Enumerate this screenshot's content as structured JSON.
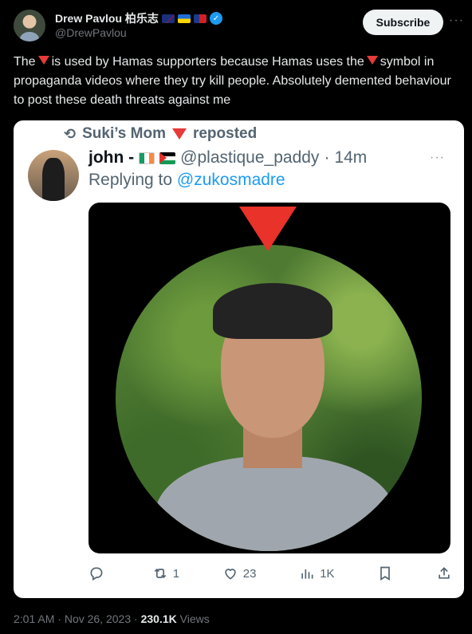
{
  "author": {
    "name": "Drew Pavlou 柏乐志",
    "handle": "@DrewPavlou",
    "subscribe_label": "Subscribe"
  },
  "tweet": {
    "text_parts": [
      "The",
      "is used by Hamas supporters because Hamas uses the",
      "symbol in propaganda videos where they try kill people. Absolutely demented behaviour to post these death threats against me"
    ],
    "time": "2:01 AM",
    "date": "Nov 26, 2023",
    "views_count": "230.1K",
    "views_label": "Views"
  },
  "embedded": {
    "reposted_by": "Suki’s Mom",
    "reposted_label": "reposted",
    "name": "john -",
    "handle": "@plastique_paddy",
    "time": "14m",
    "replying_label": "Replying to",
    "replying_to": "@zukosmadre",
    "actions": {
      "replies": "",
      "reposts": "1",
      "likes": "23",
      "views": "1K"
    }
  },
  "colors": {
    "accent": "#1d9bf0",
    "red_triangle": "#e83a3a"
  }
}
